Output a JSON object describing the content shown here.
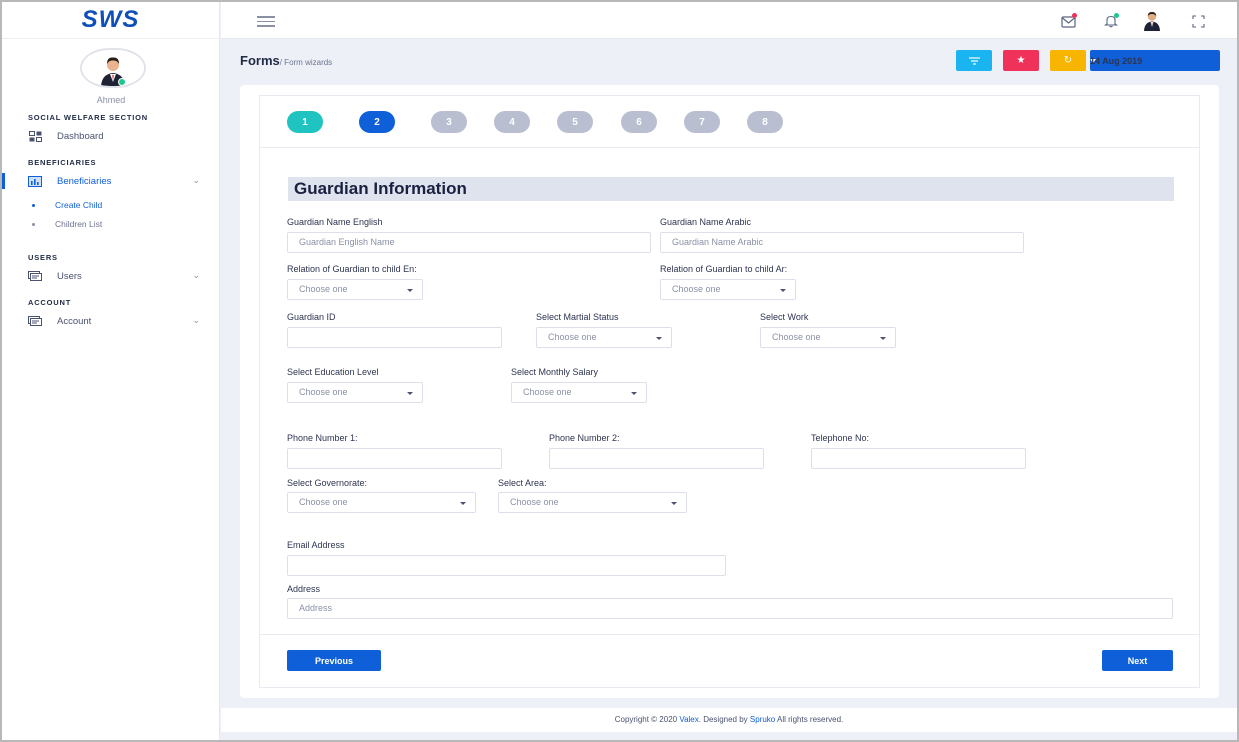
{
  "brand": "SWS",
  "user": {
    "name": "Ahmed"
  },
  "sidebar": {
    "sections": [
      {
        "title": "SOCIAL WELFARE SECTION"
      },
      {
        "title": "BENEFICIARIES"
      },
      {
        "title": "USERS"
      },
      {
        "title": "ACCOUNT"
      }
    ],
    "items": [
      {
        "label": "Dashboard"
      },
      {
        "label": "Beneficiaries"
      },
      {
        "label": "Users"
      },
      {
        "label": "Account"
      }
    ],
    "sub_items": [
      {
        "label": "Create Child"
      },
      {
        "label": "Children List"
      }
    ]
  },
  "page": {
    "title": "Forms",
    "breadcrumb": "/ Form wizards",
    "date": "14 Aug 2019"
  },
  "wizard": {
    "steps": [
      "1",
      "2",
      "3",
      "4",
      "5",
      "6",
      "7",
      "8"
    ],
    "section_title": "Guardian Information"
  },
  "form": {
    "guardian_name_en": {
      "label": "Guardian Name English",
      "placeholder": "Guardian English Name"
    },
    "guardian_name_ar": {
      "label": "Guardian Name Arabic",
      "placeholder": "Guardian Name Arabic"
    },
    "relation_en": {
      "label": "Relation of Guardian to child En:",
      "value": "Choose one"
    },
    "relation_ar": {
      "label": "Relation of Guardian to child Ar:",
      "value": "Choose one"
    },
    "guardian_id": {
      "label": "Guardian ID"
    },
    "marital_status": {
      "label": "Select Martial Status",
      "value": "Choose one"
    },
    "work": {
      "label": "Select Work",
      "value": "Choose one"
    },
    "education": {
      "label": "Select Education Level",
      "value": "Choose one"
    },
    "salary": {
      "label": "Select Monthly Salary",
      "value": "Choose one"
    },
    "phone1": {
      "label": "Phone Number 1:"
    },
    "phone2": {
      "label": "Phone Number 2:"
    },
    "telephone": {
      "label": "Telephone No:"
    },
    "governorate": {
      "label": "Select Governorate:",
      "value": "Choose one"
    },
    "area": {
      "label": "Select Area:",
      "value": "Choose one"
    },
    "email": {
      "label": "Email Address"
    },
    "address": {
      "label": "Address",
      "placeholder": "Address"
    }
  },
  "buttons": {
    "previous": "Previous",
    "next": "Next"
  },
  "footer": {
    "prefix": "Copyright © 2020 ",
    "brand_link": "Valex",
    "middle": ". Designed by ",
    "designer_link": "Spruko",
    "suffix": " All rights reserved."
  },
  "colors": {
    "primary": "#0f5fd9",
    "step_done": "#1fc4c1",
    "btn_filter": "#1ab4f0",
    "btn_star": "#f0325a",
    "btn_refresh": "#f7b500"
  },
  "icons": [
    "menu-icon",
    "mail-icon",
    "bell-icon",
    "fullscreen-icon",
    "filter-icon",
    "star-icon",
    "refresh-icon",
    "dashboard-icon",
    "chart-icon",
    "users-icon",
    "account-icon",
    "chevron-down-icon"
  ]
}
